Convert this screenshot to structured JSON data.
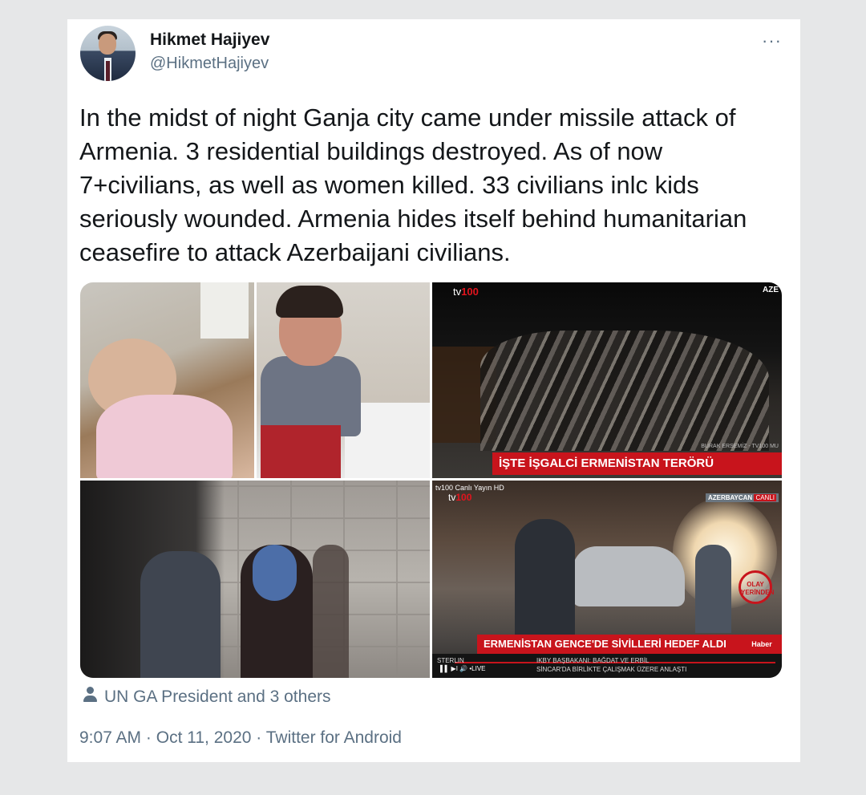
{
  "author": {
    "name": "Hikmet Hajiyev",
    "handle": "@HikmetHajiyev"
  },
  "menu_label": "···",
  "tweet": {
    "text": "In the midst of night Ganja city came under missile attack of Armenia. 3 residential buildings destroyed. As of now 7+civilians, as well as women killed. 33 civilians inlc kids seriously wounded. Armenia hides itself behind humanitarian ceasefire to attack Azerbaijani civilians."
  },
  "media": {
    "tile3": {
      "logo_prefix": "tv",
      "logo_suffix": "100",
      "corner_tag": "AZE",
      "credit": "BURAK ERSEMİZ - TV100 MU",
      "banner": "İŞTE İŞGALCİ ERMENİSTAN TERÖRÜ"
    },
    "tile5": {
      "top_label": "tv100 Canlı Yayın HD",
      "logo_prefix": "tv",
      "logo_suffix": "100",
      "country": "AZERBAYCAN",
      "live": "CANLI",
      "badge": "OLAY YERİNDEN",
      "banner": "ERMENİSTAN GENCE'DE SİVİLLERİ HEDEF ALDI",
      "haber": "Haber",
      "ticker_place": "STERLIN",
      "ticker_line1": "IKBY BAŞBAKANI: BAĞDAT VE ERBİL",
      "ticker_line2": "SİNCAR'DA BİRLİKTE ÇALIŞMAK ÜZERE ANLAŞTI",
      "controls": "▌▌  ▶I  🔊  •LIVE"
    }
  },
  "likes_text": "UN GA President and 3 others",
  "meta": {
    "time": "9:07 AM",
    "date": "Oct 11, 2020",
    "source": "Twitter for Android",
    "separator": " · "
  }
}
